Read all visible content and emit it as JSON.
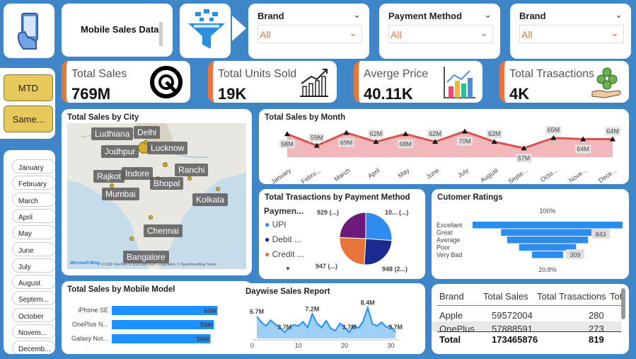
{
  "header": {
    "title": "Mobile Sales Data"
  },
  "slicers": [
    {
      "label": "Brand",
      "value": "All"
    },
    {
      "label": "Payment Method",
      "value": "All"
    },
    {
      "label": "Brand",
      "value": "All"
    }
  ],
  "buttons": {
    "mtd": "MTD",
    "same": "Same..."
  },
  "months": [
    "January",
    "February",
    "March",
    "April",
    "May",
    "June",
    "July",
    "August",
    "Septem...",
    "October",
    "Novem...",
    "Decemb..."
  ],
  "kpis": [
    {
      "label": "Total Sales",
      "value": "769M",
      "icon": "gauge-icon"
    },
    {
      "label": "Total Units Sold",
      "value": "19K",
      "icon": "growth-chart-icon"
    },
    {
      "label": "Averge Price",
      "value": "40.11K",
      "icon": "bar-chart-icon"
    },
    {
      "label": "Total Trasactions",
      "value": "4K",
      "icon": "coins-hand-icon"
    }
  ],
  "city_map": {
    "title": "Total Sales by City",
    "cities": [
      "Ludhiana",
      "Delhi",
      "Jodhpur",
      "Lucknow",
      "Rajkot",
      "Indore",
      "Ranchi",
      "Bhopal",
      "Mumbai",
      "Kolkata",
      "Chennai",
      "Bangalore"
    ],
    "attribution": "© 2025 TomTom, © 2025 Microsoft Corporation, © OpenStreetMap  Terms",
    "logo": "Microsoft Bing"
  },
  "chart_data": [
    {
      "type": "area",
      "title": "Total Sales by Month",
      "categories": [
        "January",
        "Febru...",
        "March",
        "April",
        "May",
        "June",
        "July",
        "August",
        "Septe...",
        "Octo...",
        "Nove...",
        "Dece..."
      ],
      "values": [
        68,
        59,
        69,
        62,
        68,
        62,
        70,
        62,
        57,
        65,
        64,
        64
      ],
      "data_labels": [
        "68M",
        "59M",
        "69M",
        "62M",
        "68M",
        "62M",
        "70M",
        "62M",
        "57M",
        "65M",
        "64M",
        "64M"
      ],
      "colors": {
        "line": "#d9534f",
        "fill": "#f1b7bb"
      }
    },
    {
      "type": "pie",
      "title": "Total Trasactions by Payment Method",
      "legend_title": "Paymen...",
      "legend": [
        {
          "name": "UPI",
          "color": "#2e8bf0"
        },
        {
          "name": "Debit ...",
          "color": "#1b2a8f"
        },
        {
          "name": "Credit ...",
          "color": "#e8743b"
        }
      ],
      "slices": [
        {
          "value": 1000,
          "label": "10... (...)",
          "color": "#2e8bf0"
        },
        {
          "value": 948,
          "label": "948 (2...)",
          "color": "#1b2a8f"
        },
        {
          "value": 947,
          "label": "947 (...)",
          "color": "#e8743b"
        },
        {
          "value": 929,
          "label": "929 (...)",
          "color": "#6b1a7a"
        }
      ]
    },
    {
      "type": "funnel",
      "title": "Cutomer Ratings",
      "categories": [
        "Excellant",
        "Great",
        "Average",
        "Poor",
        "Very Bad"
      ],
      "values": [
        100,
        62,
        54,
        38,
        20.8
      ],
      "top_label": "100%",
      "bottom_label": "20.8%",
      "inner_labels": [
        "843",
        "309"
      ],
      "color": "#2e8bf0"
    },
    {
      "type": "bar",
      "title": "Total Sales by Mobile Model",
      "categories": [
        "iPhone SE",
        "OnePlus N...",
        "Galaxy Not..."
      ],
      "values": [
        60,
        58,
        56
      ],
      "data_labels": [
        "60M",
        "58M",
        "56M"
      ],
      "color": "#1e90ff"
    },
    {
      "type": "area",
      "title": "Daywise Sales Report",
      "x_ticks": [
        "0",
        "10",
        "20",
        "30"
      ],
      "values": [
        6.7,
        5.6,
        4.9,
        6.0,
        5.2,
        4.6,
        3.7,
        4.5,
        5.1,
        4.9,
        5.7,
        4.6,
        7.2,
        5.4,
        4.6,
        5.9,
        4.4,
        4.0,
        5.4,
        4.6,
        3.7,
        5.0,
        4.5,
        5.8,
        8.4,
        5.3,
        4.9,
        5.6,
        4.7,
        4.8,
        3.7
      ],
      "data_labels": [
        {
          "day": 1,
          "label": "6.7M"
        },
        {
          "day": 7,
          "label": "3.7M"
        },
        {
          "day": 13,
          "label": "7.2M"
        },
        {
          "day": 21,
          "label": "3.7M"
        },
        {
          "day": 25,
          "label": "8.4M"
        },
        {
          "day": 31,
          "label": "3.7M"
        }
      ],
      "colors": {
        "line": "#1e90ff",
        "fill": "#9fd0f7"
      }
    }
  ],
  "brand_table": {
    "headers": [
      "Brand",
      "Total Sales",
      "Total Trasactions",
      "Tot"
    ],
    "rows": [
      [
        "Apple",
        "59572004",
        "280"
      ],
      [
        "OnePlus",
        "57888591",
        "273"
      ]
    ],
    "total": [
      "Total",
      "173465876",
      "819"
    ]
  }
}
